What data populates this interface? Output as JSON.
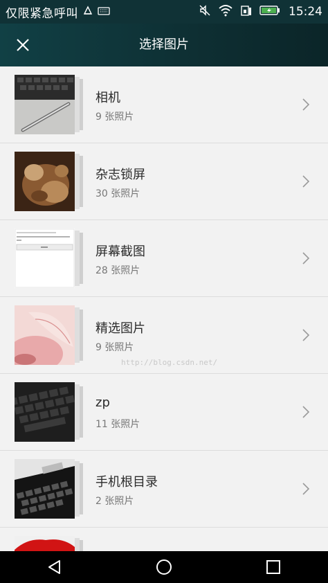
{
  "status_bar": {
    "carrier": "仅限紧急呼叫",
    "time": "15:24",
    "icons": [
      "sim-card-icon",
      "keyboard-icon",
      "mute-icon",
      "wifi-icon",
      "sim-signal-icon",
      "battery-charging-icon"
    ]
  },
  "toolbar": {
    "title": "选择图片",
    "close_icon": "close-icon"
  },
  "albums": [
    {
      "name": "相机",
      "count": "9 张照片",
      "thumb": "pen-on-keyboard"
    },
    {
      "name": "杂志锁屏",
      "count": "30 张照片",
      "thumb": "clay-sculpture"
    },
    {
      "name": "屏幕截图",
      "count": "28 张照片",
      "thumb": "screenshot"
    },
    {
      "name": "精选图片",
      "count": "9 张照片",
      "thumb": "pink-leaf"
    },
    {
      "name": "zp",
      "count": "11 张照片",
      "thumb": "black-keyboard"
    },
    {
      "name": "手机根目录",
      "count": "2 张照片",
      "thumb": "keyboard-bw"
    }
  ],
  "watermark": "http://blog.csdn.net/",
  "nav_bar": {
    "icons": [
      "back-icon",
      "home-icon",
      "recents-icon"
    ]
  },
  "colors": {
    "status_bar": "#103236",
    "toolbar": "#0e3034",
    "list_bg": "#f2f2f2",
    "nav_bar": "#000000"
  }
}
